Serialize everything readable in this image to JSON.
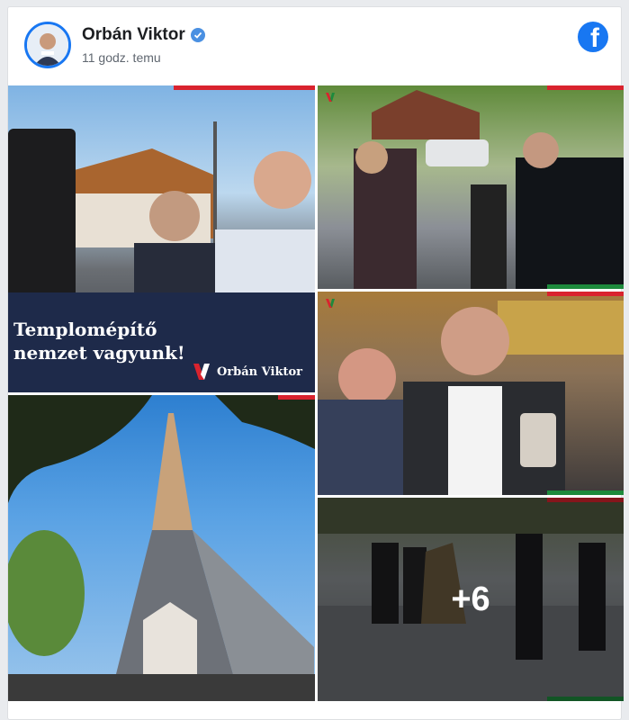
{
  "post": {
    "author_name": "Orbán Viktor",
    "timestamp": "11 godz. temu",
    "verified": true,
    "platform_icon": "facebook-icon",
    "avatar_icon": "profile-avatar"
  },
  "photos": [
    {
      "slogan_line1": "Templomépítő",
      "slogan_line2": "nemzet vagyunk!",
      "brand_text": "Orbán Viktor"
    },
    {},
    {},
    {},
    {
      "overlay_count": "+6"
    }
  ],
  "colors": {
    "accent_red": "#d9232e",
    "accent_green": "#1d8a3c",
    "facebook_blue": "#1877f2",
    "slogan_panel": "#1e2a4a"
  }
}
